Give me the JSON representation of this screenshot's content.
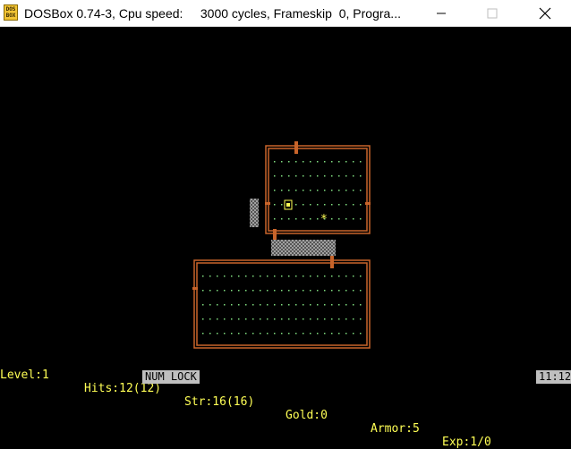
{
  "window": {
    "title": "DOSBox 0.74-3, Cpu speed:     3000 cycles, Frameskip  0, Progra...",
    "icon_text_top": "DOS",
    "icon_text_bottom": "BOX"
  },
  "controls": {
    "minimize_icon": "minimize-icon",
    "maximize_icon": "maximize-icon",
    "close_icon": "close-icon"
  },
  "status": {
    "level": "Level:1",
    "hits": "Hits:12(12)",
    "str": "Str:16(16)",
    "gold": "Gold:0",
    "armor": "Armor:5",
    "exp": "Exp:1/0"
  },
  "taskbar": {
    "numlock": "NUM LOCK",
    "clock": "11:12"
  },
  "colors": {
    "wall": "#c8642a",
    "floor": "#7fdd7f",
    "passage": "#8a8a8a",
    "status_text": "#ffff55",
    "player": "#ffff55",
    "item": "#ffff55"
  }
}
